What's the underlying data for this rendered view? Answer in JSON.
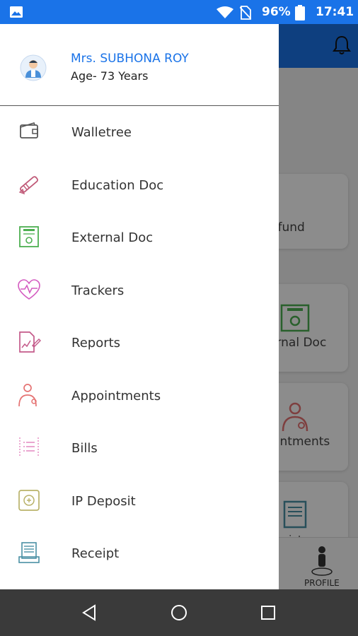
{
  "status_bar": {
    "battery_percent": "96%",
    "time": "17:41"
  },
  "background": {
    "card_labels": [
      "efund",
      "ernal Doc",
      "pintments",
      "ceipt"
    ],
    "profile_label": "PROFILE"
  },
  "drawer": {
    "user_name": "Mrs. SUBHONA ROY",
    "user_age": "Age- 73 Years",
    "items": [
      {
        "label": "Walletree",
        "icon": "wallet-icon"
      },
      {
        "label": "Education Doc",
        "icon": "diploma-icon"
      },
      {
        "label": "External Doc",
        "icon": "certificate-icon"
      },
      {
        "label": "Trackers",
        "icon": "heart-pulse-icon"
      },
      {
        "label": "Reports",
        "icon": "report-icon"
      },
      {
        "label": "Appointments",
        "icon": "doctor-icon"
      },
      {
        "label": "Bills",
        "icon": "bill-icon"
      },
      {
        "label": "IP Deposit",
        "icon": "deposit-icon"
      },
      {
        "label": "Receipt",
        "icon": "receipt-icon"
      }
    ]
  },
  "colors": {
    "accent": "#1a73e8",
    "navbar": "#3a3a3a"
  }
}
